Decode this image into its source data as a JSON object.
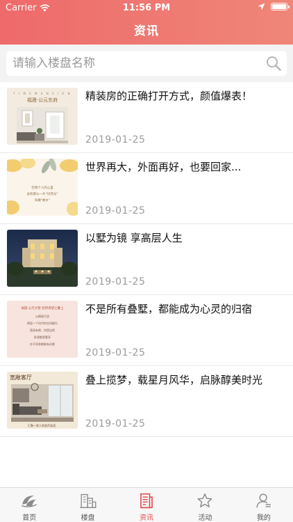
{
  "status_bar": {
    "carrier": "Carrier",
    "time": "11:56 PM"
  },
  "nav": {
    "title": "资讯"
  },
  "search": {
    "placeholder": "请输入楼盘名称",
    "value": ""
  },
  "articles": [
    {
      "title": "精装房的正确打开方式，颜值爆表！",
      "date": "2019-01-25",
      "thumb_text": [
        "福晟·公元东府"
      ]
    },
    {
      "title": "世界再大，外面再好，也要回家...",
      "date": "2019-01-25",
      "thumb_text": [
        "在每个人的心里",
        "总有那么一片\"日月光\"",
        "叫做\"故乡\""
      ]
    },
    {
      "title": "以墅为镜 享高层人生",
      "date": "2019-01-25",
      "thumb_text": []
    },
    {
      "title": "不是所有叠墅，都能成为心灵的归宿",
      "date": "2019-01-25",
      "thumb_text": [
        "福晟·公元大墅 您所渴望之叠上",
        "以精致打造",
        "择居一个时代的空间精为",
        "宽阔有缘，尚是自然",
        "卧便都是奢享",
        "在不同季都能有风景"
      ]
    },
    {
      "title": "叠上揽梦，载星月风华，启脉醇美时光",
      "date": "2019-01-25",
      "thumb_text": [
        "宽敞客厅",
        "汇聚一家人的欢声笑语"
      ]
    }
  ],
  "tabbar": {
    "tabs": [
      {
        "label": "首页",
        "icon": "home-icon",
        "active": false
      },
      {
        "label": "楼盘",
        "icon": "buildings-icon",
        "active": false
      },
      {
        "label": "资讯",
        "icon": "news-icon",
        "active": true
      },
      {
        "label": "活动",
        "icon": "star-icon",
        "active": false
      },
      {
        "label": "我的",
        "icon": "profile-icon",
        "active": false
      }
    ]
  },
  "colors": {
    "header_start": "#ee6a6b",
    "header_end": "#ef8678",
    "active_tab": "#e5484d",
    "inactive_tab": "#8a8a8a"
  }
}
